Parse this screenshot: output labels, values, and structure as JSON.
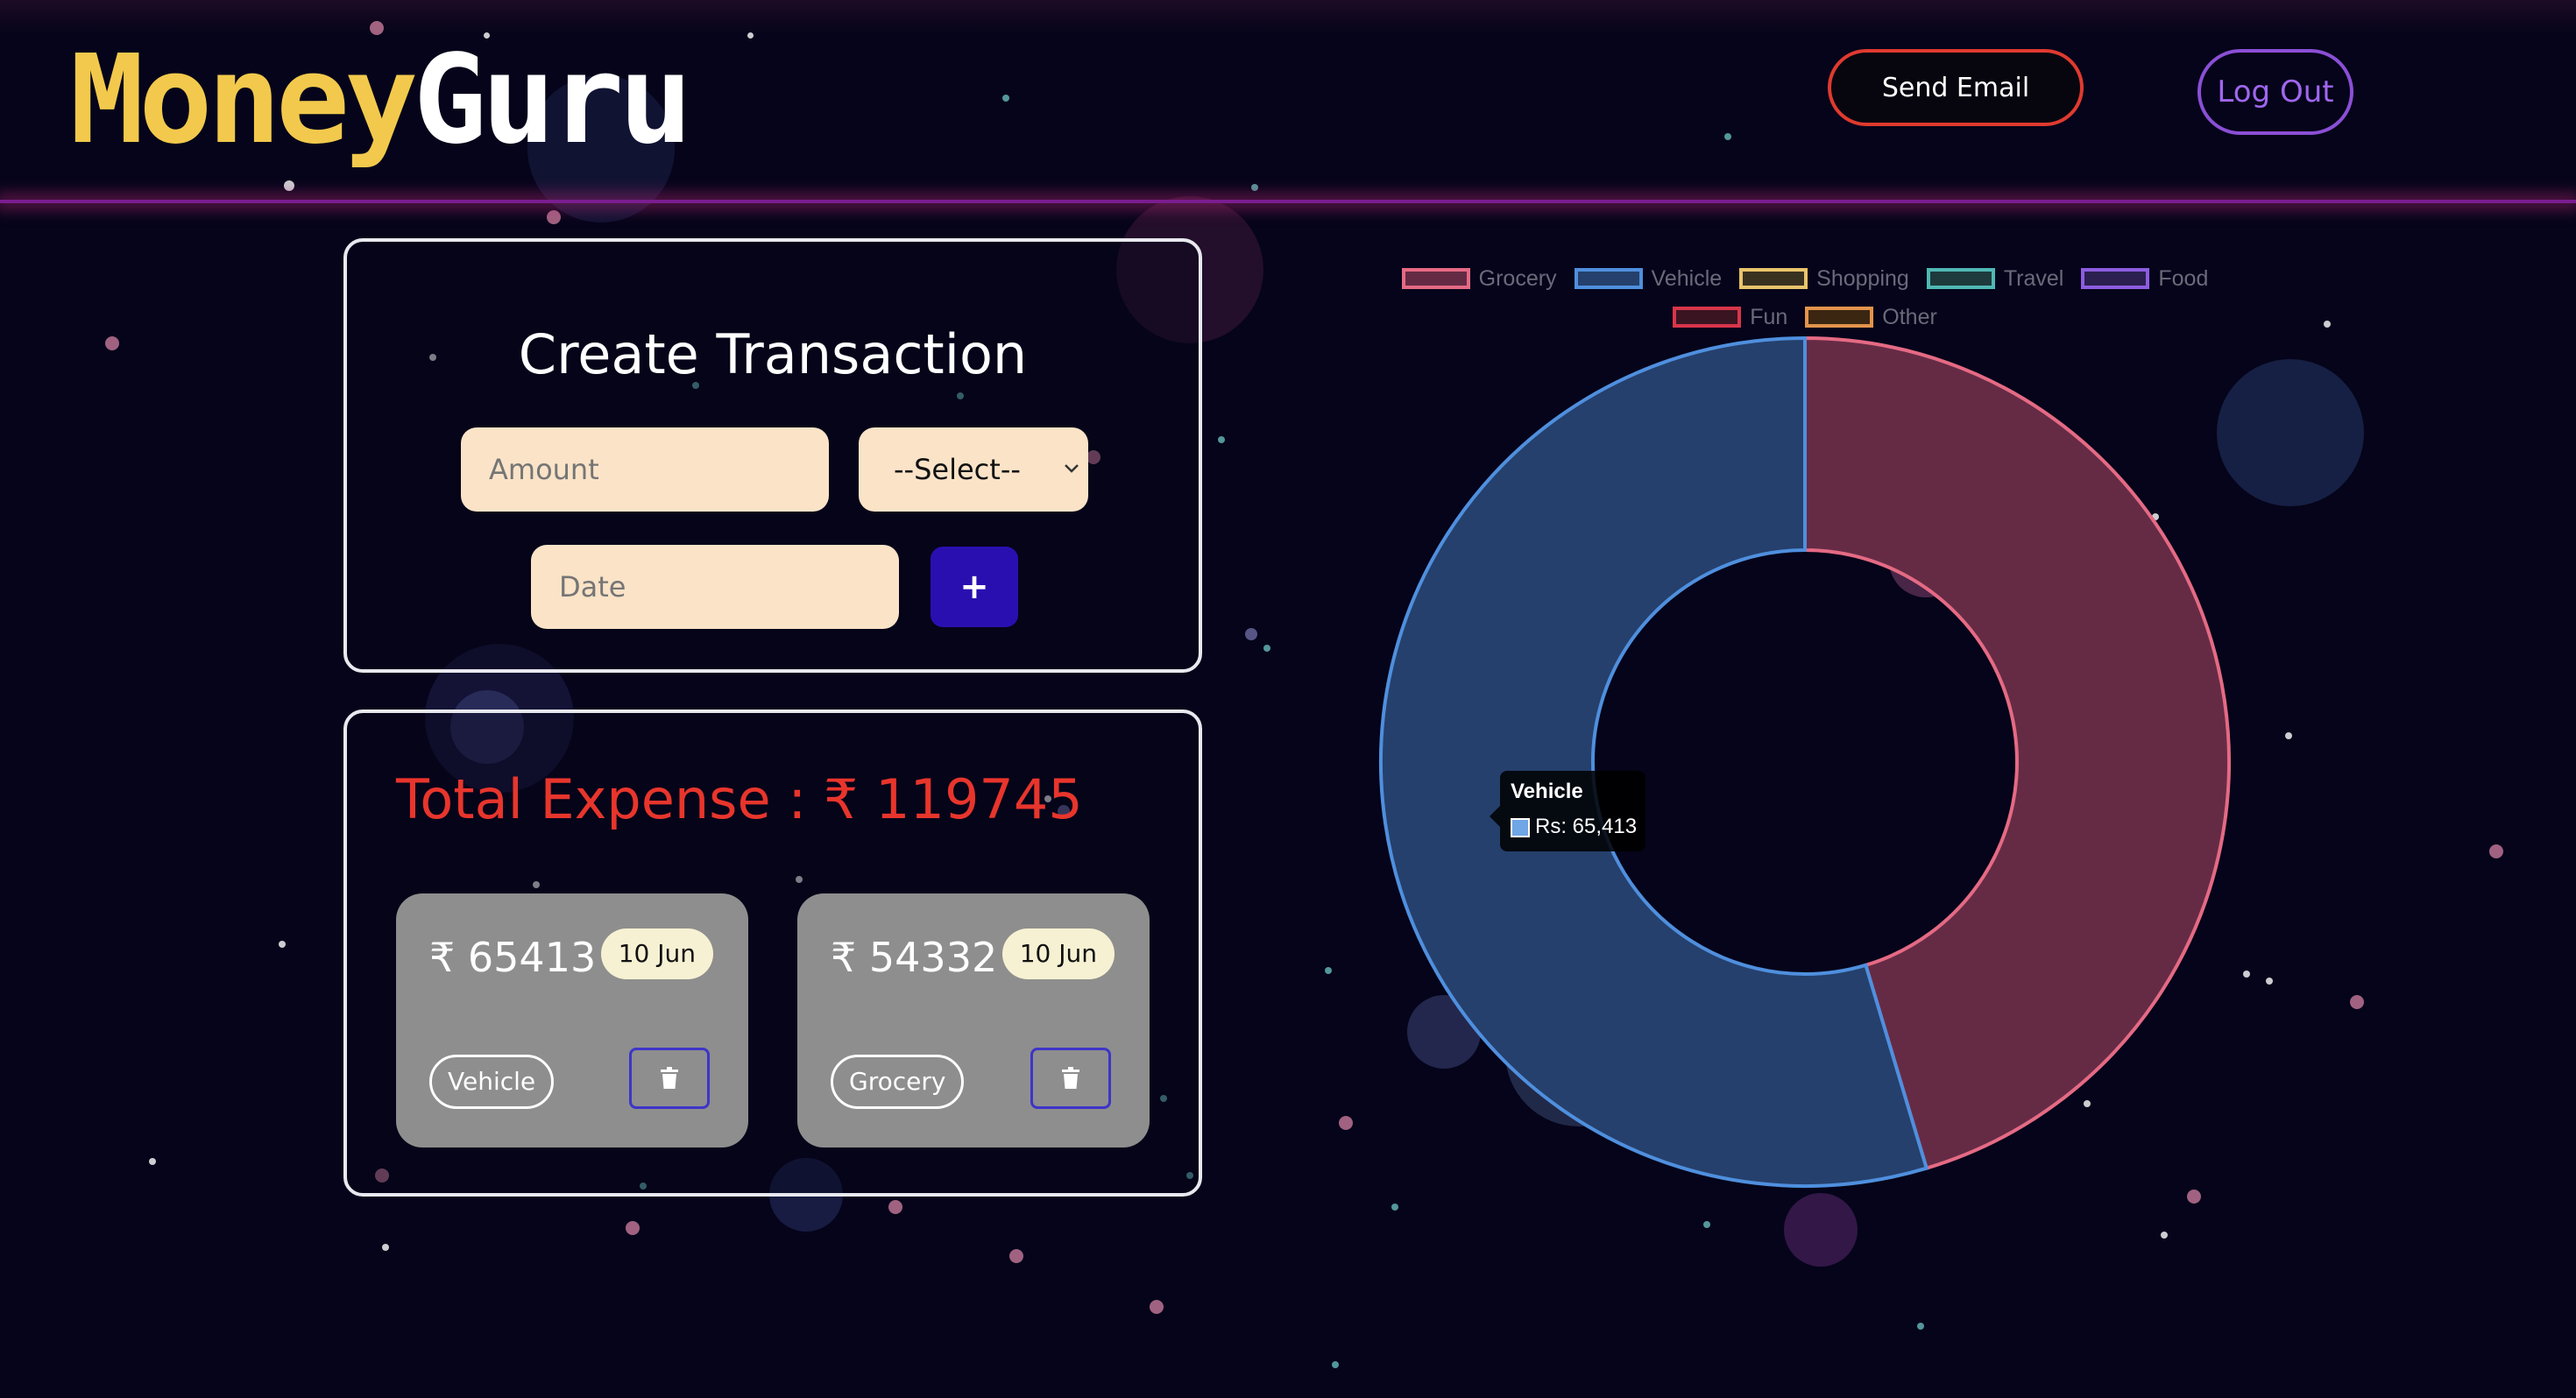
{
  "header": {
    "logo_part1": "Money",
    "logo_part2": "Guru",
    "send_email_label": "Send Email",
    "logout_label": "Log Out"
  },
  "create_transaction": {
    "title": "Create Transaction",
    "amount_placeholder": "Amount",
    "category_select_value": "--Select--",
    "date_placeholder": "Date",
    "add_label": "+"
  },
  "expenses": {
    "total_label": "Total Expense : ₹ 119745",
    "transactions": [
      {
        "amount": "₹ 65413",
        "date": "10 Jun",
        "category": "Vehicle"
      },
      {
        "amount": "₹ 54332",
        "date": "10 Jun",
        "category": "Grocery"
      }
    ]
  },
  "chart_data": {
    "type": "pie",
    "variant": "doughnut",
    "legend_position": "top",
    "categories": [
      "Grocery",
      "Vehicle",
      "Shopping",
      "Travel",
      "Food",
      "Fun",
      "Other"
    ],
    "values": [
      54332,
      65413,
      0,
      0,
      0,
      0,
      0
    ],
    "colors": {
      "Grocery": {
        "fill": "#652b45",
        "border": "#e56a84"
      },
      "Vehicle": {
        "fill": "#25406c",
        "border": "#4f8fde"
      },
      "Shopping": {
        "fill": "#3a3220",
        "border": "#e9c46a"
      },
      "Travel": {
        "fill": "#1f3a3c",
        "border": "#4fb8b4"
      },
      "Food": {
        "fill": "#2b2050",
        "border": "#8d5de0"
      },
      "Fun": {
        "fill": "#3b1422",
        "border": "#d8354a"
      },
      "Other": {
        "fill": "#3b2612",
        "border": "#e3944b"
      }
    },
    "tooltip": {
      "title": "Vehicle",
      "value": "Rs: 65,413"
    }
  },
  "theme": {
    "background": "#05041a",
    "accent_red": "#e8352c",
    "accent_purple": "#8b4fd6",
    "field_bg": "#fae3c7",
    "add_button": "#2a0fb0"
  },
  "icons": {
    "delete": "trash-icon",
    "dropdown": "chevron-down-icon"
  }
}
